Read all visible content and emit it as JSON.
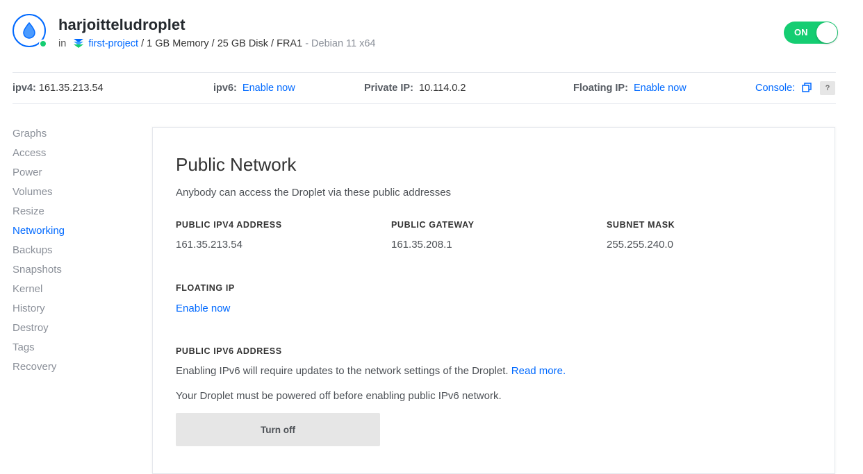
{
  "header": {
    "droplet_name": "harjoitteludroplet",
    "in_label": "in",
    "project": "first-project",
    "specs": "/ 1 GB Memory / 25 GB Disk / FRA1",
    "os": "- Debian 11 x64",
    "power_toggle": {
      "label": "ON",
      "state": "on"
    }
  },
  "ip_bar": {
    "ipv4_label": "ipv4:",
    "ipv4_value": "161.35.213.54",
    "ipv6_label": "ipv6:",
    "ipv6_link": "Enable now",
    "private_ip_label": "Private IP:",
    "private_ip_value": "10.114.0.2",
    "floating_ip_label": "Floating IP:",
    "floating_ip_link": "Enable now",
    "console_link": "Console:",
    "help_label": "?"
  },
  "sidebar": {
    "active": "Networking",
    "items": [
      {
        "label": "Graphs"
      },
      {
        "label": "Access"
      },
      {
        "label": "Power"
      },
      {
        "label": "Volumes"
      },
      {
        "label": "Resize"
      },
      {
        "label": "Networking"
      },
      {
        "label": "Backups"
      },
      {
        "label": "Snapshots"
      },
      {
        "label": "Kernel"
      },
      {
        "label": "History"
      },
      {
        "label": "Destroy"
      },
      {
        "label": "Tags"
      },
      {
        "label": "Recovery"
      }
    ]
  },
  "main": {
    "title": "Public Network",
    "description": "Anybody can access the Droplet via these public addresses",
    "public_ipv4": {
      "label": "PUBLIC IPV4 ADDRESS",
      "value": "161.35.213.54"
    },
    "public_gateway": {
      "label": "PUBLIC GATEWAY",
      "value": "161.35.208.1"
    },
    "subnet_mask": {
      "label": "SUBNET MASK",
      "value": "255.255.240.0"
    },
    "floating_ip": {
      "label": "FLOATING IP",
      "link": "Enable now"
    },
    "ipv6": {
      "label": "PUBLIC IPV6 ADDRESS",
      "note": "Enabling IPv6 will require updates to the network settings of the Droplet.",
      "read_more": "Read more.",
      "power_note": "Your Droplet must be powered off before enabling public IPv6 network.",
      "button": "Turn off"
    }
  },
  "colors": {
    "accent": "#0069ff",
    "status_green": "#15cd72",
    "muted_text": "#8a8f98"
  }
}
